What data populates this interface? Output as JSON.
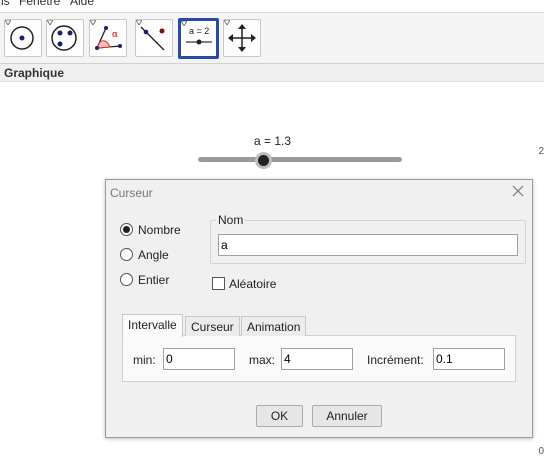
{
  "menu": {
    "items": [
      "ls",
      "Fenêtre",
      "Aide"
    ]
  },
  "toolbar": {
    "tools": [
      {
        "icon": "point-on-circle-icon"
      },
      {
        "icon": "circle-through-points-icon"
      },
      {
        "icon": "angle-icon",
        "glyph": "α"
      },
      {
        "icon": "line-through-point-icon"
      },
      {
        "icon": "slider-tool-icon",
        "glyph": "a = 2",
        "active": true
      },
      {
        "icon": "move-graphics-view-icon"
      }
    ],
    "accent": "#2a4aa8"
  },
  "graphics": {
    "header": "Graphique",
    "slider_label": "a = 1.3",
    "slider": {
      "min": 0,
      "max": 4,
      "value": 1.3
    },
    "edge_marks": [
      "2",
      "0"
    ]
  },
  "dialog": {
    "title": "Curseur",
    "type_options": [
      {
        "label": "Nombre",
        "selected": true
      },
      {
        "label": "Angle",
        "selected": false
      },
      {
        "label": "Entier",
        "selected": false
      }
    ],
    "name_group_label": "Nom",
    "name_value": "a",
    "random_label": "Aléatoire",
    "random_checked": false,
    "tabs": [
      "Intervalle",
      "Curseur",
      "Animation"
    ],
    "active_tab": "Intervalle",
    "interval": {
      "min_label": "min:",
      "min_value": "0",
      "max_label": "max:",
      "max_value": "4",
      "step_label": "Incrément:",
      "step_value": "0.1"
    },
    "ok_label": "OK",
    "cancel_label": "Annuler"
  }
}
